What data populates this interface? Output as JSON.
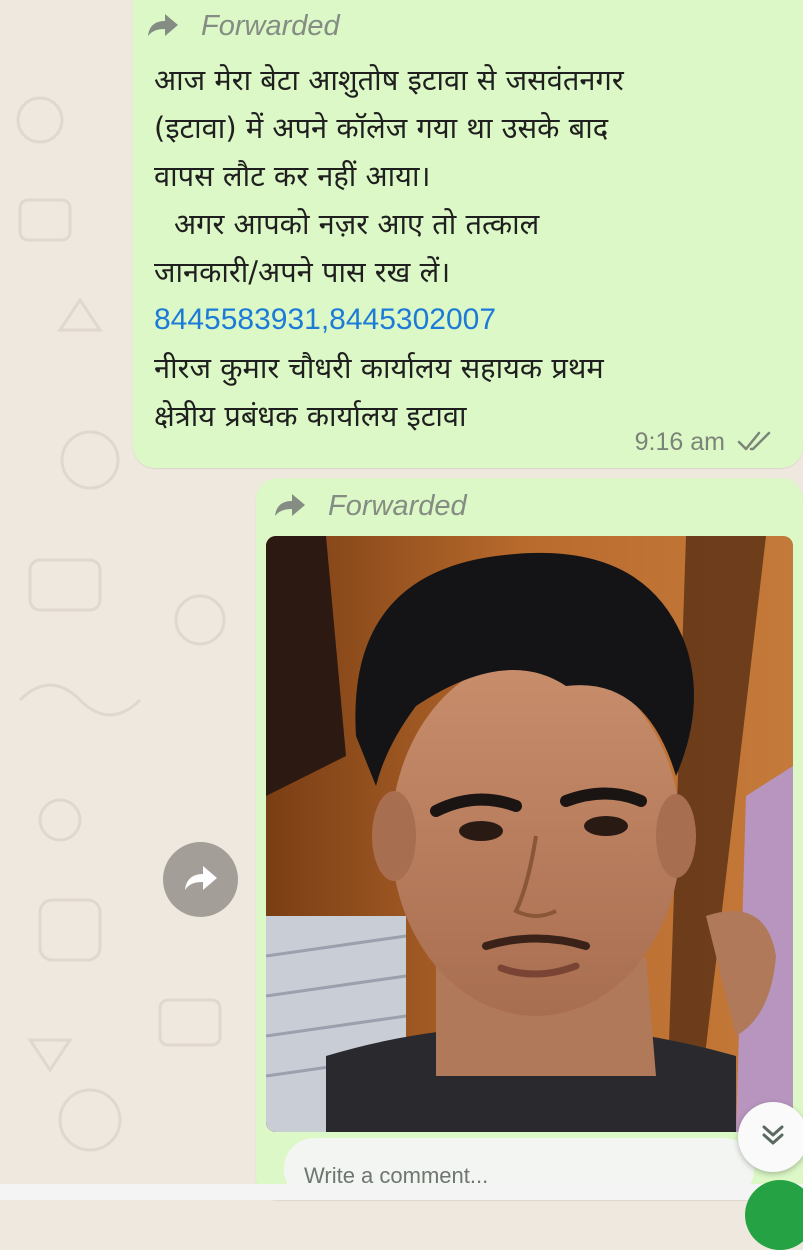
{
  "chat": {
    "message1": {
      "forwarded_label": "Forwarded",
      "lines": [
        "आज मेरा बेटा आशुतोष इटावा से जसवंतनगर",
        "(इटावा) में अपने कॉलेज गया था उसके बाद",
        "वापस लौट कर नहीं आया।",
        "अगर आपको नज़र आए तो तत्काल",
        "जानकारी/अपने पास रख लें।",
        "8445583931,8445302007",
        "नीरज कुमार चौधरी कार्यालय सहायक प्रथम",
        "क्षेत्रीय प्रबंधक कार्यालय इटावा"
      ],
      "time": "9:16 am",
      "status_icon": "double-check-icon"
    },
    "message2": {
      "forwarded_label": "Forwarded",
      "image": "photo-of-young-man",
      "comment_placeholder": "Write a comment..."
    }
  },
  "icons": {
    "forward": "forward-arrow-icon",
    "share": "share-arrow-icon",
    "scroll_down": "chevron-double-down-icon"
  },
  "colors": {
    "bubble": "#dcf8c6",
    "wallpaper": "#efe8df",
    "link": "#1d7bd8",
    "meta": "#7c8479"
  }
}
